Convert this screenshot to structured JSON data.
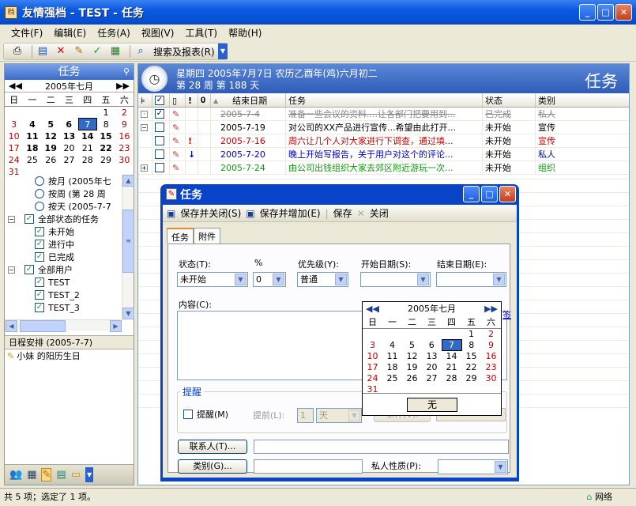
{
  "window": {
    "title": "友情强档 - TEST - 任务"
  },
  "menu": [
    "文件(F)",
    "编辑(E)",
    "任务(A)",
    "视图(V)",
    "工具(T)",
    "帮助(H)"
  ],
  "toolbar": {
    "search_label": "搜索及报表(R)"
  },
  "left": {
    "header": "任务",
    "calendar": {
      "month": "2005年七月",
      "weekdays": [
        "日",
        "一",
        "二",
        "三",
        "四",
        "五",
        "六"
      ],
      "weeks": [
        [
          "",
          "",
          "",
          "",
          "",
          "1",
          "2"
        ],
        [
          "3",
          "4",
          "5",
          "6",
          "7",
          "8",
          "9"
        ],
        [
          "10",
          "11",
          "12",
          "13",
          "14",
          "15",
          "16"
        ],
        [
          "17",
          "18",
          "19",
          "20",
          "21",
          "22",
          "23"
        ],
        [
          "24",
          "25",
          "26",
          "27",
          "28",
          "29",
          "30"
        ],
        [
          "31",
          "",
          "",
          "",
          "",
          "",
          ""
        ]
      ],
      "today": "7"
    },
    "tree": [
      {
        "text": "按月 (2005年七",
        "kind": "radio",
        "indent": 38
      },
      {
        "text": "按周 (第 28 周",
        "kind": "radio",
        "indent": 38
      },
      {
        "text": "按天 (2005-7-7",
        "kind": "radio",
        "indent": 38
      },
      {
        "text": "全部状态的任务",
        "kind": "check",
        "indent": 4,
        "expander": "−"
      },
      {
        "text": "未开始",
        "kind": "check",
        "indent": 38
      },
      {
        "text": "进行中",
        "kind": "check",
        "indent": 38
      },
      {
        "text": "已完成",
        "kind": "check",
        "indent": 38
      },
      {
        "text": "全部用户",
        "kind": "check",
        "indent": 4,
        "expander": "−"
      },
      {
        "text": "TEST",
        "kind": "check",
        "indent": 38
      },
      {
        "text": "TEST_2",
        "kind": "check",
        "indent": 38
      },
      {
        "text": "TEST_3",
        "kind": "check",
        "indent": 38
      }
    ],
    "schedule": {
      "title": "日程安排 (2005-7-7)",
      "item": "小妹 的阳历生日"
    }
  },
  "right": {
    "date_line": "星期四   2005年7月7日   农历乙酉年(鸡)六月初二",
    "week_line": "第 28 周   第 188 天",
    "big_title": "任务",
    "columns": [
      "结束日期",
      "任务",
      "状态",
      "类别"
    ],
    "rows": [
      {
        "date": "2005-7-4",
        "task": "准备一些会议的资料....让各部门把要用到...",
        "status": "已完成",
        "cat": "私人",
        "color": "strike",
        "exp": "·",
        "prio": ""
      },
      {
        "date": "2005-7-19",
        "task": "对公司的XX产品进行宣传...希望由此打开...",
        "status": "未开始",
        "cat": "宣传",
        "color": "",
        "exp": "−",
        "prio": ""
      },
      {
        "date": "2005-7-16",
        "task": "周六让几个人对大家进行下调查，通过填...",
        "status": "未开始",
        "cat": "宣传",
        "color": "c-red",
        "exp": "",
        "prio": "!"
      },
      {
        "date": "2005-7-20",
        "task": "晚上开始写报告，关于用户对这个的评论...",
        "status": "未开始",
        "cat": "私人",
        "color": "c-blue",
        "exp": "",
        "prio": "↓"
      },
      {
        "date": "2005-7-24",
        "task": "由公司出钱组织大家去郊区附近游玩一次...",
        "status": "未开始",
        "cat": "组织",
        "color": "c-green",
        "exp": "+",
        "prio": ""
      }
    ]
  },
  "status_bar": {
    "text": "共 5 项；选定了 1 项。",
    "network": "网络"
  },
  "dialog": {
    "title": "任务",
    "tool_save_close": "保存并关闭(S)",
    "tool_save_add": "保存并增加(E)",
    "tool_save": "保存",
    "tool_close": "关闭",
    "tabs": [
      "任务",
      "附件"
    ],
    "status_label": "状态(T):",
    "status_value": "未开始",
    "percent_label": "%",
    "percent_value": "0",
    "priority_label": "优先级(Y):",
    "priority_value": "普通",
    "start_label": "开始日期(S):",
    "end_label": "结束日期(E):",
    "content_label": "内容(C):",
    "reminder_group": "提醒",
    "reminder_check": "提醒(M)",
    "advance_label": "提前(L):",
    "advance_value": "1",
    "advance_unit": "天",
    "event_btn": "事件(V):",
    "contacts_btn": "联系人(T)...",
    "category_btn": "类别(G)...",
    "private_label": "私人性质(P):",
    "popup": {
      "month": "2005年七月",
      "none_btn": "无",
      "link": "签"
    }
  }
}
